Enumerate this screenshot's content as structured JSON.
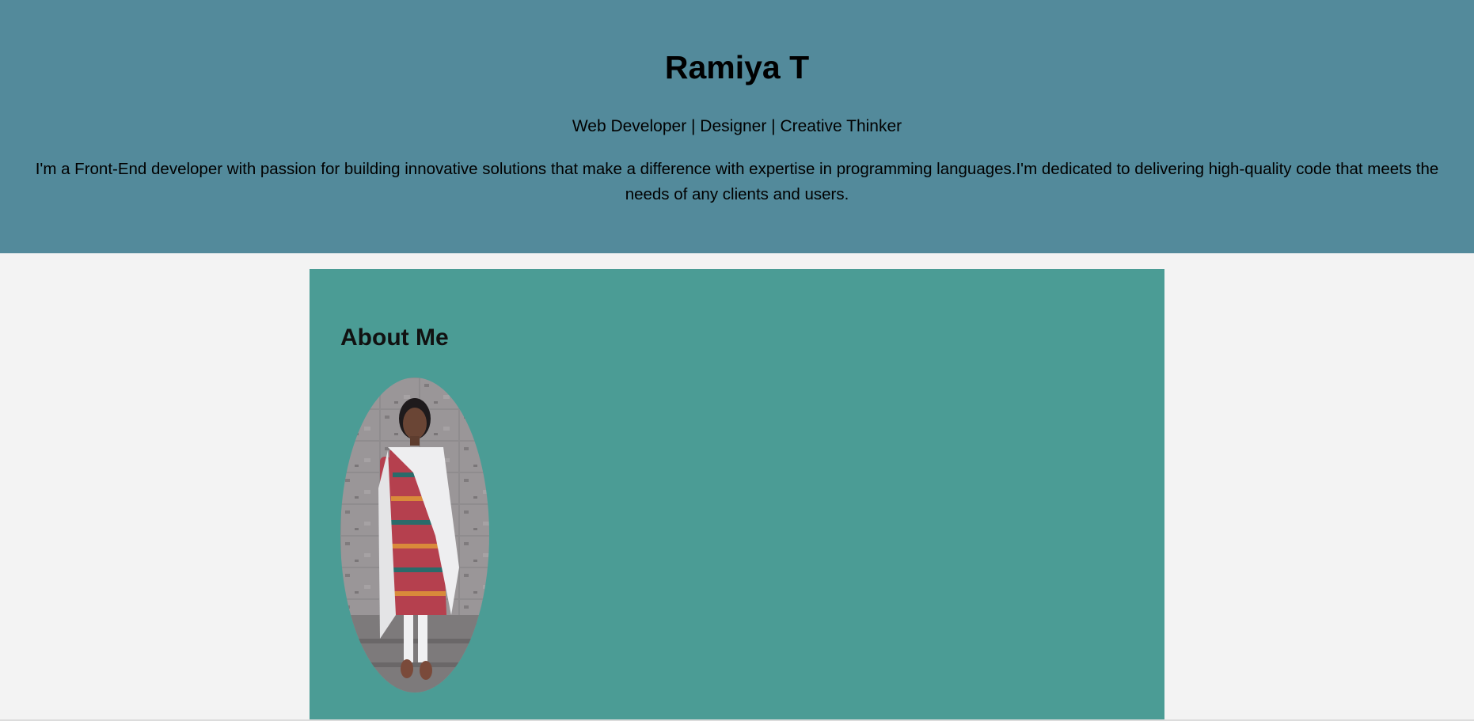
{
  "header": {
    "name": "Ramiya T",
    "tagline": "Web Developer | Designer | Creative Thinker",
    "bio": "I'm a Front-End developer with passion for building innovative solutions that make a difference with expertise in programming languages.I'm dedicated to delivering high-quality code that meets the needs of any clients and users."
  },
  "about": {
    "heading": "About Me"
  },
  "colors": {
    "header_bg": "#538a9b",
    "page_bg": "#f3f3f3",
    "about_bg": "#4b9c95"
  }
}
